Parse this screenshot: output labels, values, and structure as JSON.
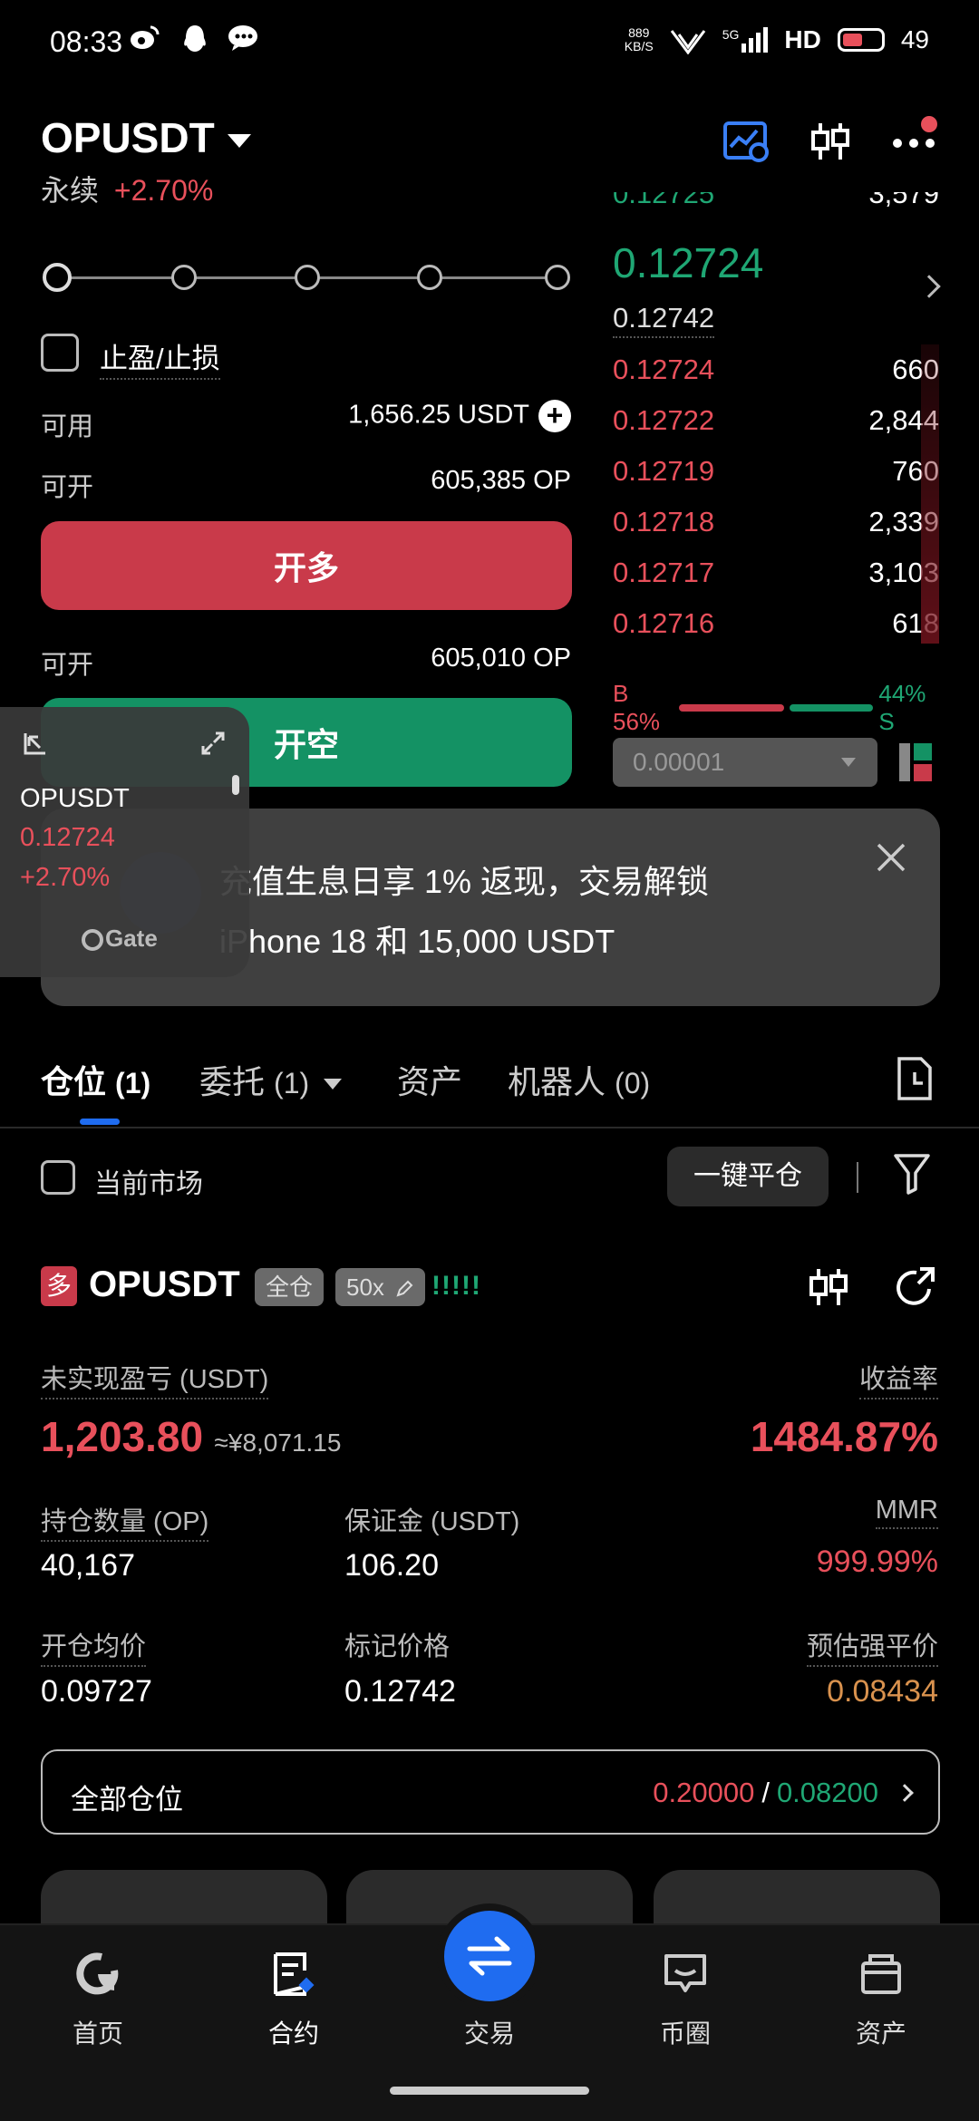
{
  "status_bar": {
    "time": "08:33",
    "net_speed_value": "889",
    "net_speed_unit": "KB/S",
    "signal": "5G",
    "hd": "HD",
    "battery": "49",
    "app_icons": [
      "weibo-icon",
      "qq-icon",
      "wechat-icon"
    ]
  },
  "header": {
    "pair": "OPUSDT",
    "contract_type": "永续",
    "change": "+2.70%"
  },
  "order_form": {
    "leverage_slider_level": 0,
    "tp_sl_label": "止盈/止损",
    "available_label": "可用",
    "available_value": "1,656.25 USDT",
    "open_long_label": "可开",
    "open_long_value": "605,385 OP",
    "long_button": "开多",
    "open_short_label": "可开",
    "open_short_value": "605,010 OP",
    "short_button": "开空"
  },
  "order_book": {
    "partial_top_price": "0.12725",
    "partial_top_qty": "3,579",
    "last_price": "0.12724",
    "mark_price": "0.12742",
    "bids": [
      {
        "price": "0.12724",
        "qty": "660",
        "depth": 0.05
      },
      {
        "price": "0.12722",
        "qty": "2,844",
        "depth": 0.08
      },
      {
        "price": "0.12719",
        "qty": "760",
        "depth": 0.1
      },
      {
        "price": "0.12718",
        "qty": "2,339",
        "depth": 0.12
      },
      {
        "price": "0.12717",
        "qty": "3,103",
        "depth": 0.14
      },
      {
        "price": "0.12716",
        "qty": "618",
        "depth": 0.15
      }
    ],
    "buy_ratio": "B 56%",
    "sell_ratio": "44% S",
    "buy_percent": 56,
    "sell_percent": 44,
    "tick_size": "0.00001"
  },
  "float_widget": {
    "symbol": "OPUSDT",
    "price": "0.12724",
    "change": "+2.70%",
    "brand": "Gate"
  },
  "promo": {
    "line1": "充值生息日享 1% 返现，交易解锁",
    "line2": "iPhone 18 和 15,000 USDT"
  },
  "tabs": [
    {
      "label": "仓位",
      "count": "(1)"
    },
    {
      "label": "委托",
      "count": "(1)"
    },
    {
      "label": "资产",
      "count": ""
    },
    {
      "label": "机器人",
      "count": "(0)"
    }
  ],
  "filter": {
    "current_market_label": "当前市场",
    "close_all_button": "一键平仓"
  },
  "position": {
    "side_badge": "多",
    "symbol": "OPUSDT",
    "margin_mode": "全仓",
    "leverage": "50x",
    "bars": "!!!!!",
    "unrealized_pnl_label": "未实现盈亏 (USDT)",
    "unrealized_pnl_value": "1,203.80",
    "unrealized_pnl_cny": "≈¥8,071.15",
    "roe_label": "收益率",
    "roe_value": "1484.87%",
    "size_label": "持仓数量 (OP)",
    "size_value": "40,167",
    "margin_label": "保证金 (USDT)",
    "margin_value": "106.20",
    "mmr_label": "MMR",
    "mmr_value": "999.99%",
    "entry_label": "开仓均价",
    "entry_value": "0.09727",
    "mark_label": "标记价格",
    "mark_value": "0.12742",
    "liq_label": "预估强平价",
    "liq_value": "0.08434",
    "all_positions_label": "全部仓位",
    "tp_value": "0.20000",
    "separator": "/",
    "sl_value": "0.08200"
  },
  "bottom_nav": [
    {
      "label": "首页",
      "icon": "home-icon"
    },
    {
      "label": "合约",
      "icon": "contract-icon"
    },
    {
      "label": "交易",
      "icon": "swap-icon"
    },
    {
      "label": "币圈",
      "icon": "community-icon"
    },
    {
      "label": "资产",
      "icon": "wallet-icon"
    }
  ],
  "colors": {
    "up_red": "#e8505b",
    "down_green": "#1fa774",
    "accent_blue": "#1f6cf0",
    "background": "#000000",
    "liq_orange": "#d9924e"
  }
}
